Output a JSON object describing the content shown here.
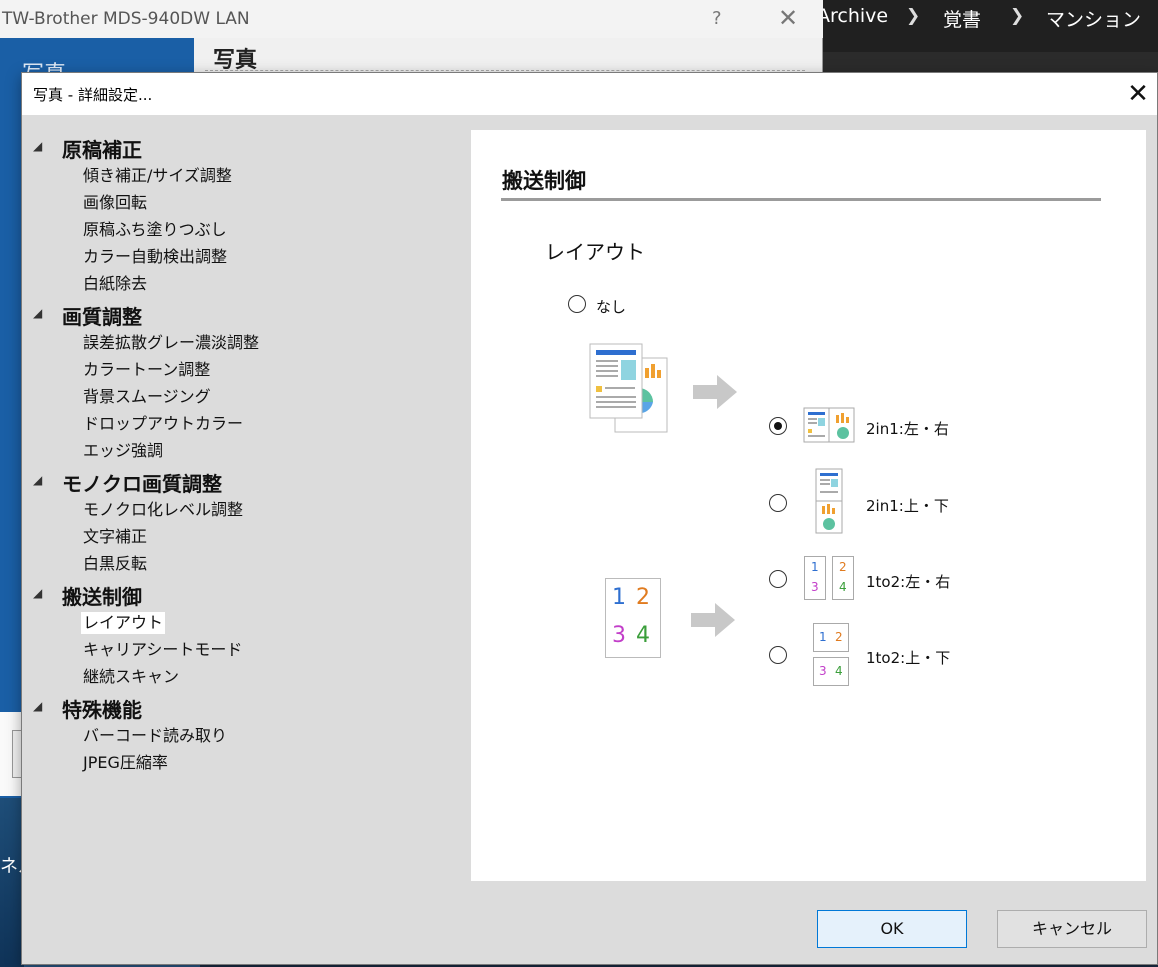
{
  "explorer": {
    "breadcrumb": [
      "Archive",
      "覚書",
      "マンション"
    ]
  },
  "desktop": {
    "fragment_text": "ネル"
  },
  "parent_dialog": {
    "title": "TW-Brother MDS-940DW LAN",
    "help_label": "?",
    "close_label": "✕",
    "side_label": "写真",
    "heading": "写真"
  },
  "dialog": {
    "title": "写真 - 詳細設定...",
    "close_label": "✕",
    "ok_label": "OK",
    "cancel_label": "キャンセル"
  },
  "tree": {
    "expander_glyph": "◢",
    "groups": [
      {
        "label": "原稿補正",
        "children": [
          "傾き補正/サイズ調整",
          "画像回転",
          "原稿ふち塗りつぶし",
          "カラー自動検出調整",
          "白紙除去"
        ]
      },
      {
        "label": "画質調整",
        "children": [
          "誤差拡散グレー濃淡調整",
          "カラートーン調整",
          "背景スムージング",
          "ドロップアウトカラー",
          "エッジ強調"
        ]
      },
      {
        "label": "モノクロ画質調整",
        "children": [
          "モノクロ化レベル調整",
          "文字補正",
          "白黒反転"
        ]
      },
      {
        "label": "搬送制御",
        "children": [
          "レイアウト",
          "キャリアシートモード",
          "継続スキャン"
        ]
      },
      {
        "label": "特殊機能",
        "children": [
          "バーコード読み取り",
          "JPEG圧縮率"
        ]
      }
    ],
    "selected": "レイアウト"
  },
  "panel": {
    "title": "搬送制御",
    "section_label": "レイアウト",
    "options": {
      "none": "なし",
      "2in1_lr": "2in1:左・右",
      "2in1_tb": "2in1:上・下",
      "1to2_lr": "1to2:左・右",
      "1to2_tb": "1to2:上・下"
    },
    "selected_option": "2in1:左・右",
    "number_glyphs": [
      "1",
      "2",
      "3",
      "4"
    ]
  },
  "colors": {
    "accent": "#0078d7",
    "parent_sidebar": "#1a5fa6",
    "digit_1": "#2e6fd0",
    "digit_2": "#e07b1f",
    "digit_3": "#c23ec9",
    "digit_4": "#3a9e3a"
  }
}
